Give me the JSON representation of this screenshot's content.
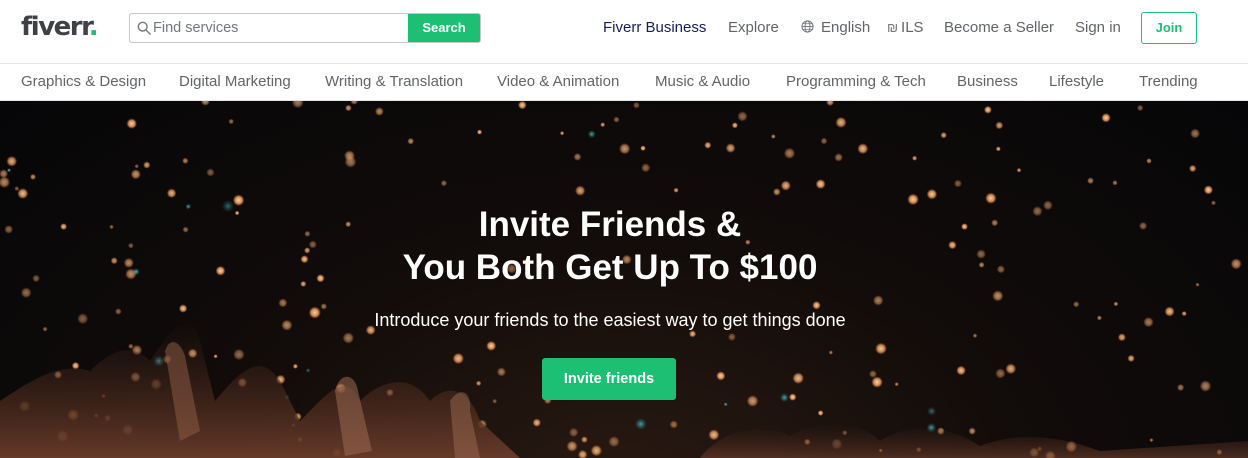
{
  "header": {
    "logo_text": "fiverr",
    "logo_dot": ".",
    "search": {
      "placeholder": "Find services",
      "button_label": "Search"
    },
    "nav": {
      "business": "Fiverr Business",
      "explore": "Explore",
      "language": "English",
      "currency_symbol": "₪",
      "currency": "ILS",
      "become_seller": "Become a Seller",
      "sign_in": "Sign in",
      "join": "Join"
    }
  },
  "categories": [
    "Graphics & Design",
    "Digital Marketing",
    "Writing & Translation",
    "Video & Animation",
    "Music & Audio",
    "Programming & Tech",
    "Business",
    "Lifestyle",
    "Trending"
  ],
  "hero": {
    "title_line1": "Invite Friends &",
    "title_line2": "You Both Get Up To $100",
    "subtitle": "Introduce your friends to the easiest way to get things done",
    "cta_label": "Invite friends"
  },
  "colors": {
    "brand_green": "#1dbf73",
    "business_blue": "#1a1c5a",
    "text_gray": "#62646a"
  },
  "icons": [
    "search-icon",
    "globe-icon",
    "currency-icon"
  ]
}
